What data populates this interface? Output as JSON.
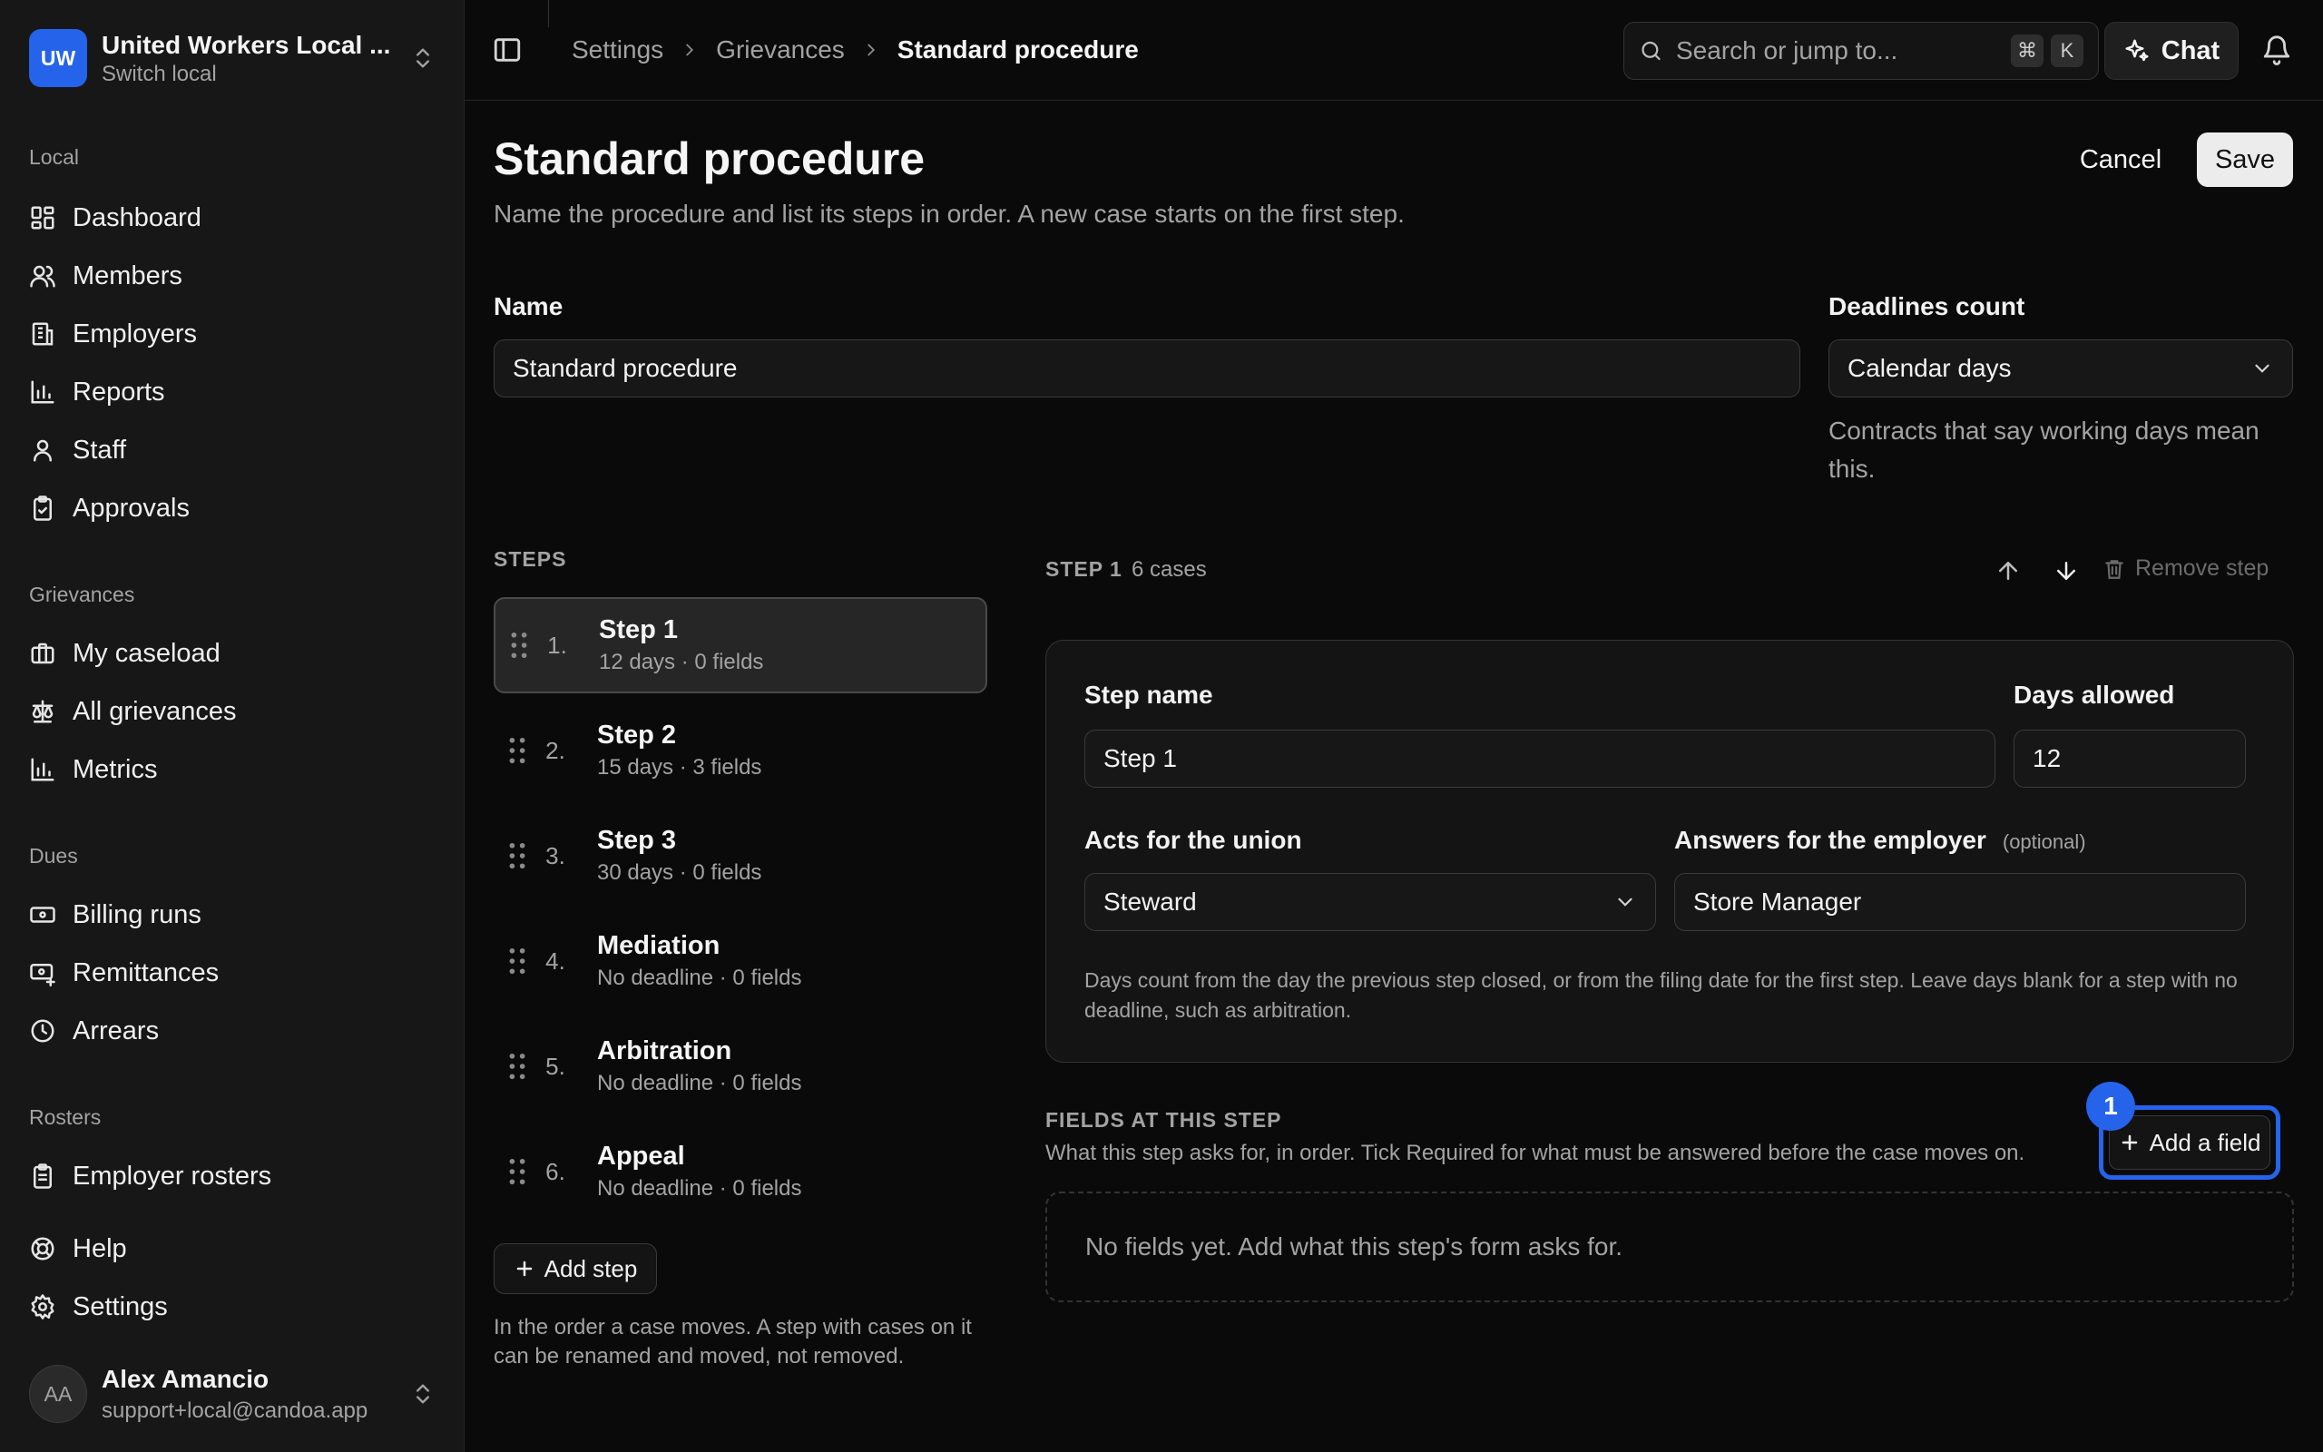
{
  "org": {
    "initials": "UW",
    "name": "United Workers Local ...",
    "switch_label": "Switch local"
  },
  "sidebar": {
    "sections": [
      {
        "label": "Local",
        "items": [
          {
            "label": "Dashboard",
            "icon": "dashboard-icon"
          },
          {
            "label": "Members",
            "icon": "members-icon"
          },
          {
            "label": "Employers",
            "icon": "building-icon"
          },
          {
            "label": "Reports",
            "icon": "bar-chart-icon"
          },
          {
            "label": "Staff",
            "icon": "user-icon"
          },
          {
            "label": "Approvals",
            "icon": "clipboard-check-icon"
          }
        ]
      },
      {
        "label": "Grievances",
        "items": [
          {
            "label": "My caseload",
            "icon": "briefcase-icon"
          },
          {
            "label": "All grievances",
            "icon": "scale-icon"
          },
          {
            "label": "Metrics",
            "icon": "bar-chart-icon"
          }
        ]
      },
      {
        "label": "Dues",
        "items": [
          {
            "label": "Billing runs",
            "icon": "banknote-icon"
          },
          {
            "label": "Remittances",
            "icon": "remittance-icon"
          },
          {
            "label": "Arrears",
            "icon": "clock-icon"
          }
        ]
      },
      {
        "label": "Rosters",
        "items": [
          {
            "label": "Employer rosters",
            "icon": "clipboard-list-icon"
          }
        ]
      }
    ],
    "bottom_items": [
      {
        "label": "Help",
        "icon": "help-icon"
      },
      {
        "label": "Settings",
        "icon": "gear-icon"
      }
    ]
  },
  "user": {
    "initials": "AA",
    "name": "Alex Amancio",
    "email": "support+local@candoa.app"
  },
  "breadcrumb": [
    "Settings",
    "Grievances",
    "Standard procedure"
  ],
  "search": {
    "placeholder": "Search or jump to...",
    "key1": "⌘",
    "key2": "K"
  },
  "chat_label": "Chat",
  "page": {
    "title": "Standard procedure",
    "subtitle": "Name the procedure and list its steps in order. A new case starts on the first step.",
    "cancel": "Cancel",
    "save": "Save"
  },
  "form": {
    "name_label": "Name",
    "name_value": "Standard procedure",
    "deadlines_label": "Deadlines count",
    "deadlines_value": "Calendar days",
    "deadlines_help": "Contracts that say working days mean this."
  },
  "steps": {
    "section_label": "STEPS",
    "items": [
      {
        "num": "1.",
        "name": "Step 1",
        "meta": "12 days · 0 fields"
      },
      {
        "num": "2.",
        "name": "Step 2",
        "meta": "15 days · 3 fields"
      },
      {
        "num": "3.",
        "name": "Step 3",
        "meta": "30 days · 0 fields"
      },
      {
        "num": "4.",
        "name": "Mediation",
        "meta": "No deadline · 0 fields"
      },
      {
        "num": "5.",
        "name": "Arbitration",
        "meta": "No deadline · 0 fields"
      },
      {
        "num": "6.",
        "name": "Appeal",
        "meta": "No deadline · 0 fields"
      }
    ],
    "add_step": "Add step",
    "note": "In the order a case moves. A step with cases on it can be renamed and moved, not removed."
  },
  "step_detail": {
    "label": "STEP 1",
    "count": "6 cases",
    "remove": "Remove step",
    "step_name_label": "Step name",
    "step_name_value": "Step 1",
    "days_label": "Days allowed",
    "days_value": "12",
    "union_label": "Acts for the union",
    "union_value": "Steward",
    "employer_label": "Answers for the employer",
    "employer_optional": "(optional)",
    "employer_value": "Store Manager",
    "help": "Days count from the day the previous step closed, or from the filing date for the first step. Leave days blank for a step with no deadline, such as arbitration."
  },
  "fields": {
    "title": "FIELDS AT THIS STEP",
    "description": "What this step asks for, in order. Tick Required for what must be answered before the case moves on.",
    "add_field": "Add a field",
    "badge": "1",
    "empty": "No fields yet. Add what this step's form asks for."
  }
}
